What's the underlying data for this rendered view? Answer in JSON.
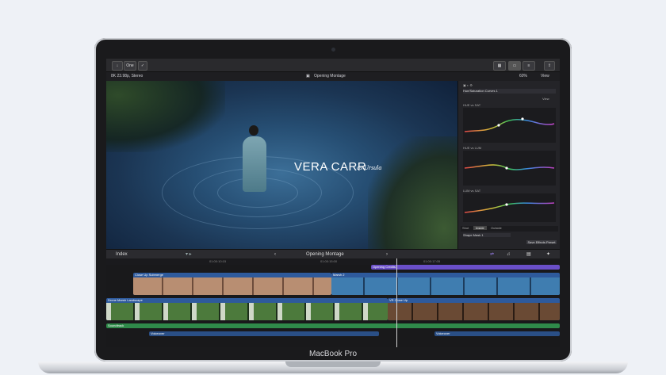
{
  "device": {
    "brand_label": "MacBook Pro"
  },
  "toolbar": {
    "share_label": "One"
  },
  "viewer": {
    "format_label": "8K 23.98p, Stereo",
    "project_title": "Opening Montage",
    "zoom_label": "60%",
    "view_label": "View",
    "title_name": "VERA CARR",
    "title_role": "as Ursula"
  },
  "inspector": {
    "effect_name": "Hue/Saturation Curves 1",
    "view_label": "View",
    "curve_labels": [
      "HUE vs SAT",
      "HUE vs LUM",
      "LUM vs SAT"
    ],
    "tabs": [
      "Shot",
      "Inside",
      "Outside"
    ],
    "shape_label": "Shape Mask 1",
    "save_label": "Save Effects Preset"
  },
  "timeline": {
    "index_label": "Index",
    "project_label": "Opening Montage",
    "timecodes": [
      "01:00:10:15",
      "01:00:15:00",
      "01:00:17:05"
    ],
    "clips": {
      "opening_credits": "Opening Credits",
      "close_up_submerge": "Close Up Submerge",
      "marsh": "Marsh 2",
      "drone_landscape": "Drone Marsh Landscape",
      "vera_close": "VR Close Up",
      "soundtrack": "Soundtrack",
      "voiceover_a": "Voiceover",
      "voiceover_b": "Voiceover"
    }
  },
  "colors": {
    "accent": "#5b3fb0",
    "clip_blue": "#2e5a9c",
    "audio_green": "#2f8a4a"
  }
}
